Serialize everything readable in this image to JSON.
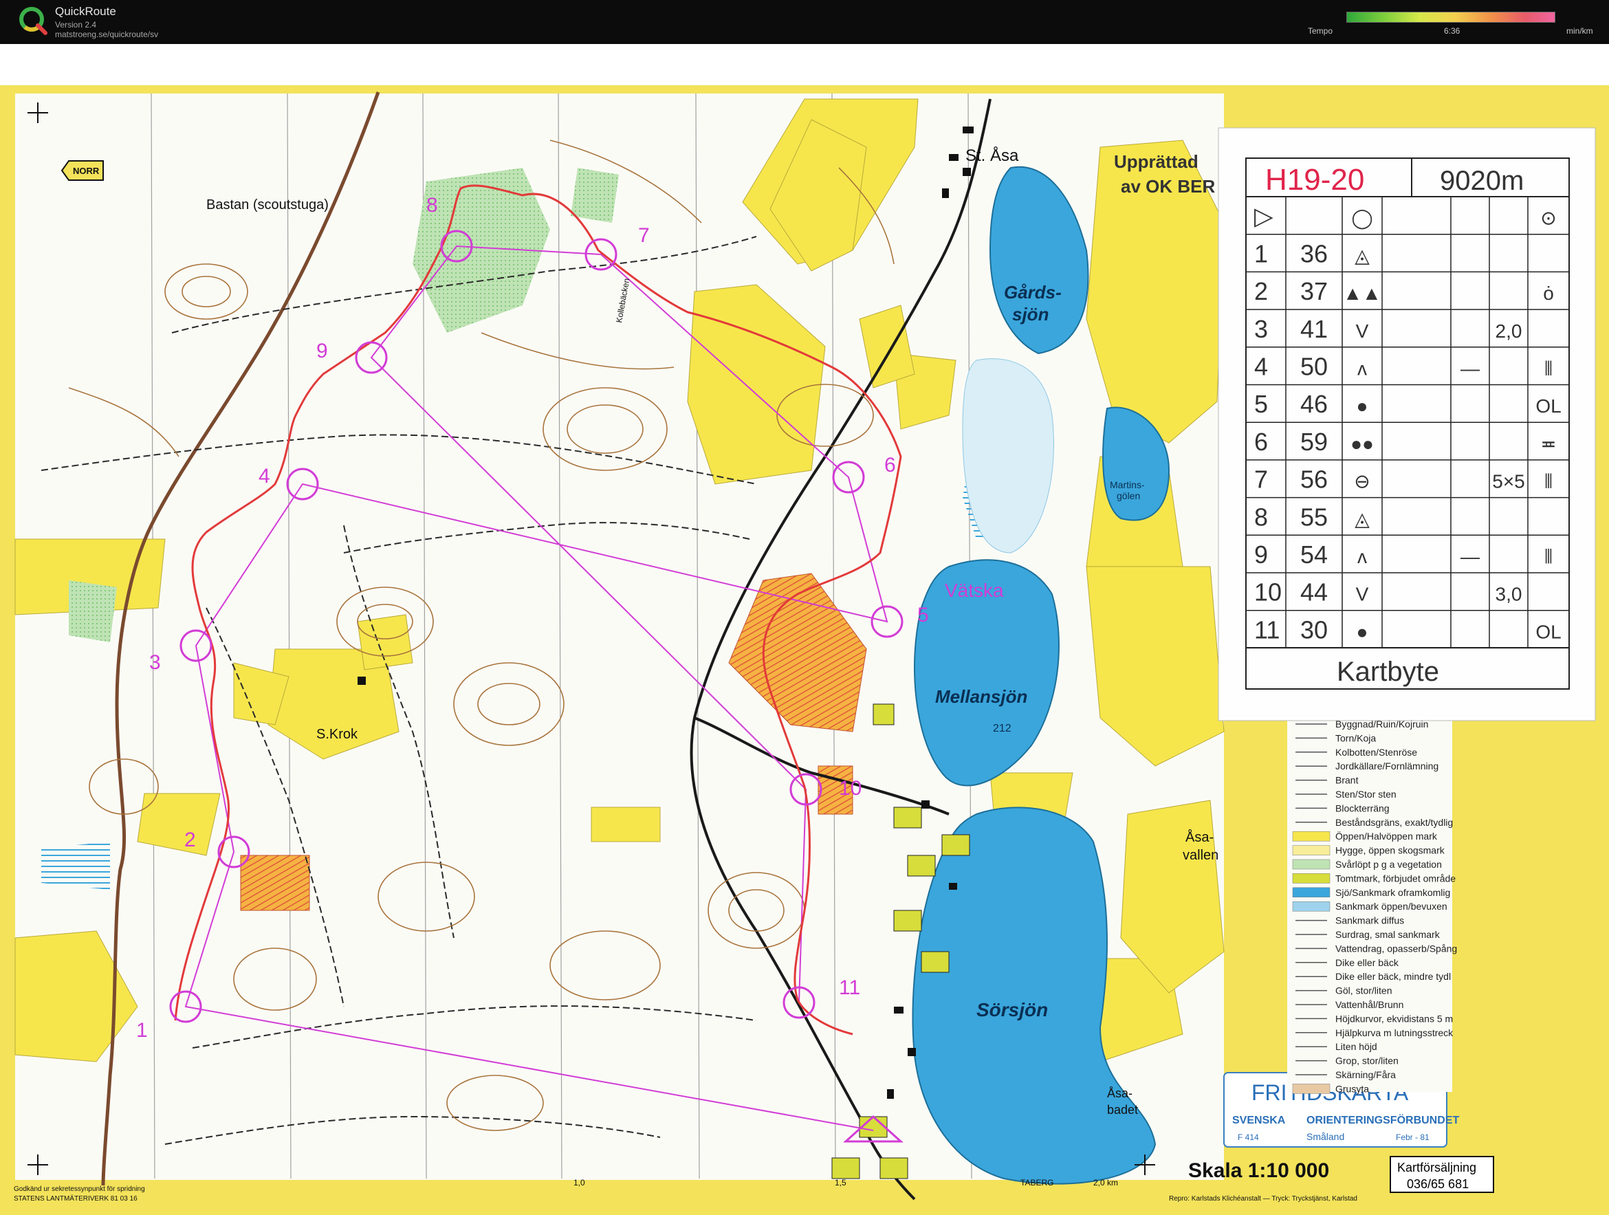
{
  "app": {
    "title": "QuickRoute",
    "version": "Version 2.4",
    "url": "matstroeng.se/quickroute/sv"
  },
  "tempo": {
    "label": "Tempo",
    "mid_value": "6:36",
    "unit": "min/km"
  },
  "colors": {
    "map_yellow": "#f6e64c",
    "lake_blue": "#3aa6dc",
    "course_purple": "#d23cd6",
    "route_red": "#e23a3a",
    "road_black": "#1a1a1a",
    "track_brown": "#7a4a2e"
  },
  "map": {
    "place_labels": {
      "st_asa": "St. Åsa",
      "upprattad_1": "Upprättad",
      "upprattad_2": "av OK BER",
      "bastan": "Bastan (scoutstuga)",
      "norr": "NORR",
      "gards_1": "Gårds-",
      "gards_2": "sjön",
      "martins_1": "Martins-",
      "martins_2": "gölen",
      "vatska": "Vätska",
      "mellansjon": "Mellansjön",
      "height_212": "212",
      "krok": "S.Krok",
      "sorsjon": "Sörsjön",
      "asavallen_1": "Åsa-",
      "asavallen_2": "vallen",
      "asabadet_1": "Åsa-",
      "asabadet_2": "badet",
      "kollebacken": "Kollebäcken",
      "taberg": "TABERG",
      "scale_text": "Skala 1:10 000",
      "sales_1": "Kartförsäljning",
      "sales_2": "036/65 681",
      "approved_1": "Godkänd ur sekretessynpunkt för spridning",
      "approved_2": "STATENS LANTMÄTERIVERK  81 03 16",
      "repro": "Repro: Karlstads Klichéanstalt — Tryck: Tryckstjänst, Karlstad",
      "fritidskarta": "FRITIDSKARTA",
      "sof_1": "SVENSKA",
      "sof_2": "ORIENTERINGSFÖRBUNDET",
      "f414": "F 414",
      "smaland": "Småland",
      "febr": "Febr - 81",
      "grid_1_0": "1,0",
      "grid_1_5": "1,5",
      "grid_2_0": "2,0 km"
    },
    "controls": [
      {
        "label": "1"
      },
      {
        "label": "2"
      },
      {
        "label": "3"
      },
      {
        "label": "4"
      },
      {
        "label": "5"
      },
      {
        "label": "6"
      },
      {
        "label": "7"
      },
      {
        "label": "8"
      },
      {
        "label": "9"
      },
      {
        "label": "10"
      },
      {
        "label": "11"
      }
    ],
    "legend": [
      "Byggnad/Ruin/Kojruin",
      "Torn/Koja",
      "Kolbotten/Stenröse",
      "Jordkällare/Fornlämning",
      "Brant",
      "Sten/Stor sten",
      "Blockterräng",
      "Beståndsgräns, exakt/tydlig",
      "Öppen/Halvöppen mark",
      "Hygge, öppen skogsmark",
      "Svårlöpt p g a vegetation",
      "Tomtmark, förbjudet område",
      "Sjö/Sankmark oframkomlig",
      "Sankmark öppen/bevuxen",
      "Sankmark diffus",
      "Surdrag, smal sankmark",
      "Vattendrag, opasserb/Spång",
      "Dike eller bäck",
      "Dike eller bäck, mindre tydl",
      "Göl, stor/liten",
      "Vattenhål/Brunn",
      "Höjdkurvor, ekvidistans 5 m",
      "Hjälpkurva m lutningsstreck",
      "Liten höjd",
      "Grop, stor/liten",
      "Skärning/Fåra",
      "Grusyta"
    ]
  },
  "control_card": {
    "class": "H19-20",
    "distance": "9020m",
    "footer": "Kartbyte",
    "rows": [
      {
        "nr": "▷",
        "code": "",
        "feature": "◯",
        "detail": "",
        "size": "",
        "pos": "⊙"
      },
      {
        "nr": "1",
        "code": "36",
        "feature": "◬",
        "detail": "",
        "size": "",
        "pos": ""
      },
      {
        "nr": "2",
        "code": "37",
        "feature": "▲▲",
        "detail": "",
        "size": "",
        "pos": "ȯ"
      },
      {
        "nr": "3",
        "code": "41",
        "feature": "V",
        "detail": "",
        "size": "2,0",
        "pos": ""
      },
      {
        "nr": "4",
        "code": "50",
        "feature": "ᴧ",
        "detail": "—",
        "size": "",
        "pos": "⫴"
      },
      {
        "nr": "5",
        "code": "46",
        "feature": "●",
        "detail": "",
        "size": "",
        "pos": "OL"
      },
      {
        "nr": "6",
        "code": "59",
        "feature": "●●",
        "detail": "",
        "size": "",
        "pos": "≖"
      },
      {
        "nr": "7",
        "code": "56",
        "feature": "⊖",
        "detail": "",
        "size": "5×5",
        "pos": "⫴"
      },
      {
        "nr": "8",
        "code": "55",
        "feature": "◬",
        "detail": "",
        "size": "",
        "pos": ""
      },
      {
        "nr": "9",
        "code": "54",
        "feature": "ᴧ",
        "detail": "—",
        "size": "",
        "pos": "⫴"
      },
      {
        "nr": "10",
        "code": "44",
        "feature": "V",
        "detail": "",
        "size": "3,0",
        "pos": ""
      },
      {
        "nr": "11",
        "code": "30",
        "feature": "●",
        "detail": "",
        "size": "",
        "pos": "OL"
      }
    ]
  }
}
